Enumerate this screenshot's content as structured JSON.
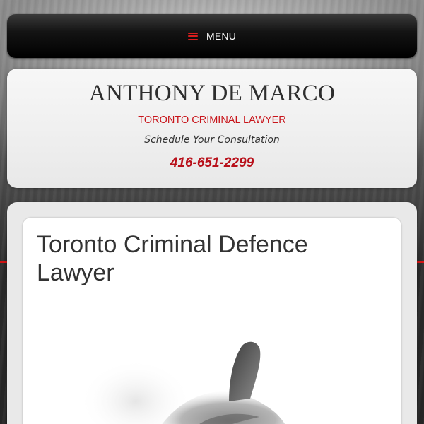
{
  "nav": {
    "menu_label": "MENU",
    "menu_icon": "hamburger-menu-icon",
    "accent_color": "#d81e1e"
  },
  "header": {
    "site_title": "ANTHONY DE MARCO",
    "subtitle": "TORONTO CRIMINAL LAWYER",
    "tagline": "Schedule Your Consultation",
    "phone": "416-651-2299",
    "subtitle_color": "#c8151b",
    "phone_color": "#b8101a"
  },
  "main": {
    "page_title": "Toronto Criminal Defence Lawyer",
    "hero_image": "hand-pointing-image"
  }
}
